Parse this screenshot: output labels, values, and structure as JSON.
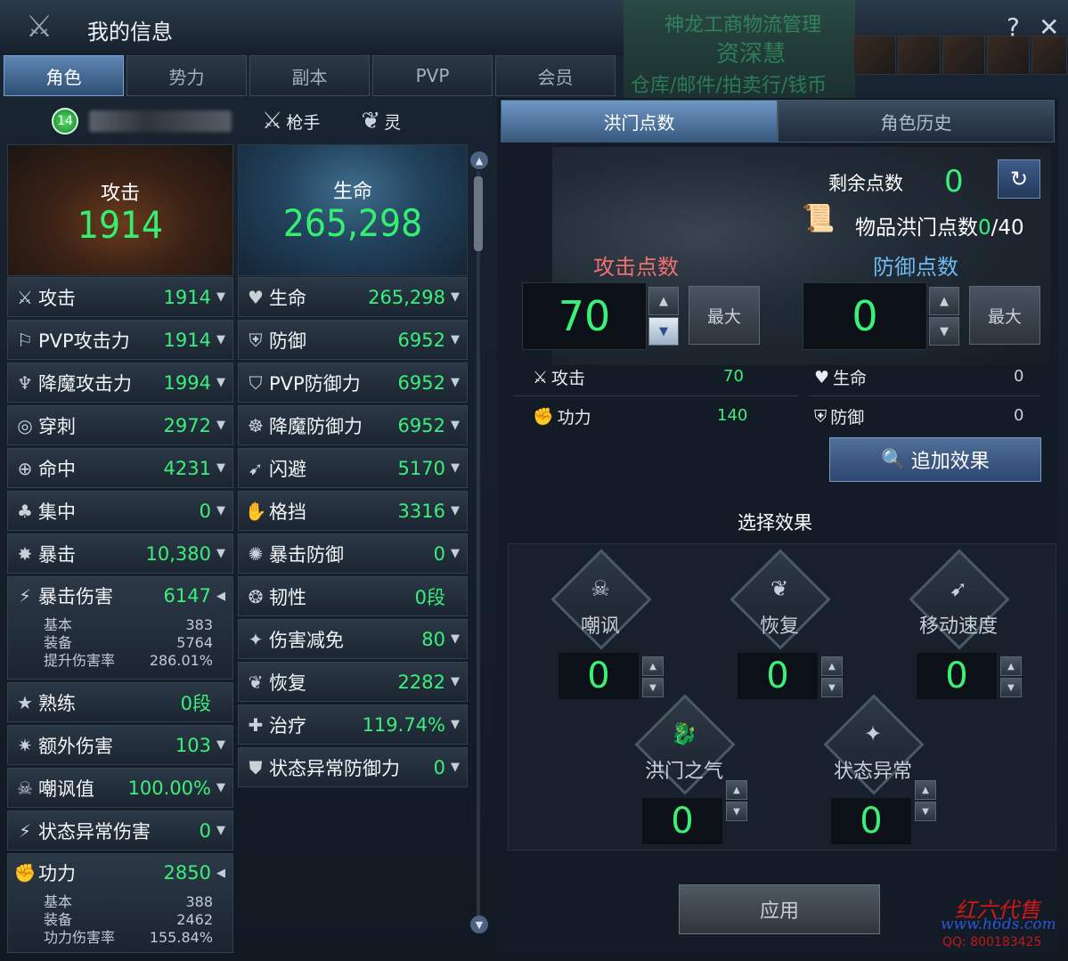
{
  "window": {
    "title": "我的信息",
    "help_label": "?",
    "close_label": "✕"
  },
  "background_text": [
    "神龙工商物流管理",
    "资深慧",
    "仓库/邮件/拍卖行/钱币"
  ],
  "tabs": [
    "角色",
    "势力",
    "副本",
    "PVP",
    "会员"
  ],
  "character": {
    "level": "14",
    "class_name": "枪手",
    "element": "灵"
  },
  "summary": {
    "attack_label": "攻击",
    "attack_value": "1914",
    "hp_label": "生命",
    "hp_value": "265,298"
  },
  "left_stats": [
    {
      "name": "攻击",
      "value": "1914",
      "icon": "crossed-swords-icon"
    },
    {
      "name": "PVP攻击力",
      "value": "1914",
      "icon": "pvp-attack-icon"
    },
    {
      "name": "降魔攻击力",
      "value": "1994",
      "icon": "demon-attack-icon"
    },
    {
      "name": "穿刺",
      "value": "2972",
      "icon": "pierce-icon"
    },
    {
      "name": "命中",
      "value": "4231",
      "icon": "target-icon"
    },
    {
      "name": "集中",
      "value": "0",
      "icon": "focus-icon"
    },
    {
      "name": "暴击",
      "value": "10,380",
      "icon": "critical-icon"
    },
    {
      "name": "暴击伤害",
      "value": "6147",
      "icon": "critical-damage-icon"
    },
    {
      "name": "熟练",
      "value": "0段",
      "icon": "mastery-icon"
    },
    {
      "name": "额外伤害",
      "value": "103",
      "icon": "extra-damage-icon"
    },
    {
      "name": "嘲讽值",
      "value": "100.00%",
      "icon": "skull-icon"
    },
    {
      "name": "状态异常伤害",
      "value": "0",
      "icon": "status-damage-icon"
    },
    {
      "name": "功力",
      "value": "2850",
      "icon": "power-icon"
    }
  ],
  "crit_detail": [
    {
      "label": "基本",
      "value": "383"
    },
    {
      "label": "装备",
      "value": "5764"
    },
    {
      "label": "提升伤害率",
      "value": "286.01%"
    }
  ],
  "power_detail": [
    {
      "label": "基本",
      "value": "388"
    },
    {
      "label": "装备",
      "value": "2462"
    },
    {
      "label": "功力伤害率",
      "value": "155.84%"
    }
  ],
  "right_stats": [
    {
      "name": "生命",
      "value": "265,298",
      "icon": "heart-icon"
    },
    {
      "name": "防御",
      "value": "6952",
      "icon": "shield-icon"
    },
    {
      "name": "PVP防御力",
      "value": "6952",
      "icon": "pvp-defense-icon"
    },
    {
      "name": "降魔防御力",
      "value": "6952",
      "icon": "demon-defense-icon"
    },
    {
      "name": "闪避",
      "value": "5170",
      "icon": "evade-icon"
    },
    {
      "name": "格挡",
      "value": "3316",
      "icon": "block-icon"
    },
    {
      "name": "暴击防御",
      "value": "0",
      "icon": "crit-defense-icon"
    },
    {
      "name": "韧性",
      "value": "0段",
      "icon": "tenacity-icon"
    },
    {
      "name": "伤害减免",
      "value": "80",
      "icon": "damage-reduction-icon"
    },
    {
      "name": "恢复",
      "value": "2282",
      "icon": "recovery-icon"
    },
    {
      "name": "治疗",
      "value": "119.74%",
      "icon": "heal-icon"
    },
    {
      "name": "状态异常防御力",
      "value": "0",
      "icon": "status-defense-icon"
    }
  ],
  "right_tabs": [
    "洪门点数",
    "角色历史"
  ],
  "points": {
    "remaining_label": "剩余点数",
    "remaining_value": "0",
    "item_points_label": "物品洪门点数",
    "item_points_current": "0",
    "item_points_max": "/40",
    "attack_label": "攻击点数",
    "attack_value": "70",
    "defense_label": "防御点数",
    "defense_value": "0",
    "max_label": "最大",
    "bonuses": [
      {
        "name": "攻击",
        "value": "70",
        "icon": "crossed-swords-icon"
      },
      {
        "name": "生命",
        "value": "0",
        "icon": "heart-icon"
      },
      {
        "name": "功力",
        "value": "140",
        "icon": "power-icon"
      },
      {
        "name": "防御",
        "value": "0",
        "icon": "shield-icon"
      }
    ],
    "add_effect_label": "追加效果"
  },
  "effects": {
    "title": "选择效果",
    "items": [
      {
        "name": "嘲讽",
        "value": "0",
        "icon": "skull-icon"
      },
      {
        "name": "恢复",
        "value": "0",
        "icon": "sprout-icon"
      },
      {
        "name": "移动速度",
        "value": "0",
        "icon": "running-icon"
      },
      {
        "name": "洪门之气",
        "value": "0",
        "icon": "dragon-icon"
      },
      {
        "name": "状态异常",
        "value": "0",
        "icon": "star-icon"
      }
    ],
    "apply_label": "应用"
  },
  "watermark": {
    "line1": "红六代售",
    "line2": "www.h6ds.com",
    "line3": "QQ: 800183425"
  },
  "colors": {
    "value_green": "#3af07a",
    "attack_points": "#f07070",
    "defense_points": "#70b8f0",
    "accent_blue": "#5d86b3"
  }
}
